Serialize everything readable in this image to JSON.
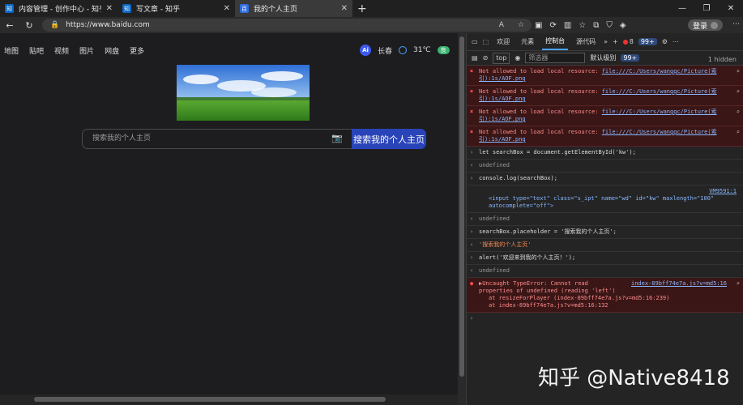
{
  "browser": {
    "tabs": [
      {
        "icon": "知",
        "title": "内容管理 - 创作中心 - 知乎"
      },
      {
        "icon": "知",
        "title": "写文章 - 知乎"
      },
      {
        "icon": "百",
        "title": "我的个人主页",
        "active": true
      }
    ],
    "url": "https://www.baidu.com",
    "login_label": "登录",
    "new_tab": "+",
    "window_controls": [
      "—",
      "❐",
      "✕"
    ]
  },
  "page": {
    "nav": [
      "地图",
      "贴吧",
      "视频",
      "图片",
      "网盘",
      "更多"
    ],
    "city": "长春",
    "temp": "31℃",
    "aqi": "良",
    "ai_label": "Ai",
    "search_placeholder": "搜索我的个人主页",
    "search_button": "搜索我的个人主页"
  },
  "devtools": {
    "tabs": [
      "欢迎",
      "元素",
      "控制台",
      "源代码"
    ],
    "error_count": "8",
    "message_count": "99+",
    "context": "top",
    "filter_placeholder": "筛选器",
    "levels": "默认级别",
    "level_badge": "99+",
    "hidden": "1 hidden",
    "console": [
      {
        "type": "err",
        "text": "Not allowed to load local resource: ",
        "link": "file:///C:/Users/wanggc/Picture(索引):1s/AOF.png"
      },
      {
        "type": "err",
        "text": "Not allowed to load local resource: ",
        "link": "file:///C:/Users/wanggc/Picture(索引):1s/AOF.png"
      },
      {
        "type": "err",
        "text": "Not allowed to load local resource: ",
        "link": "file:///C:/Users/wanggc/Picture(索引):1s/AOF.png"
      },
      {
        "type": "err",
        "text": "Not allowed to load local resource: ",
        "link": "file:///C:/Users/wanggc/Picture(索引):1s/AOF.png"
      }
    ],
    "cmd1": "let searchBox = document.getElementById('kw');",
    "undef": "undefined",
    "cmd2": "console.log(searchBox);",
    "vm_src": "VM9591:1",
    "input_el": "<input type=\"text\" class=\"s_ipt\" name=\"wd\" id=\"kw\" maxlength=\"100\" autocomplete=\"off\">",
    "cmd3": "searchBox.placeholder = '搜索我的个人主页';",
    "out3": "'搜索我的个人主页'",
    "cmd4": "alert('欢迎来到我的个人主页！');",
    "error_text": "▶Uncaught TypeError: Cannot read properties of undefined (reading 'left')",
    "error_src": "index-89bff74e7a.js?v=md5:16",
    "at1": "at resizeForPlayer (index-89bff74e7a.js?v=md5:16:239)",
    "at2": "at index-89bff74e7a.js?v=md5:16:132"
  },
  "watermark": "知乎 @Native8418"
}
